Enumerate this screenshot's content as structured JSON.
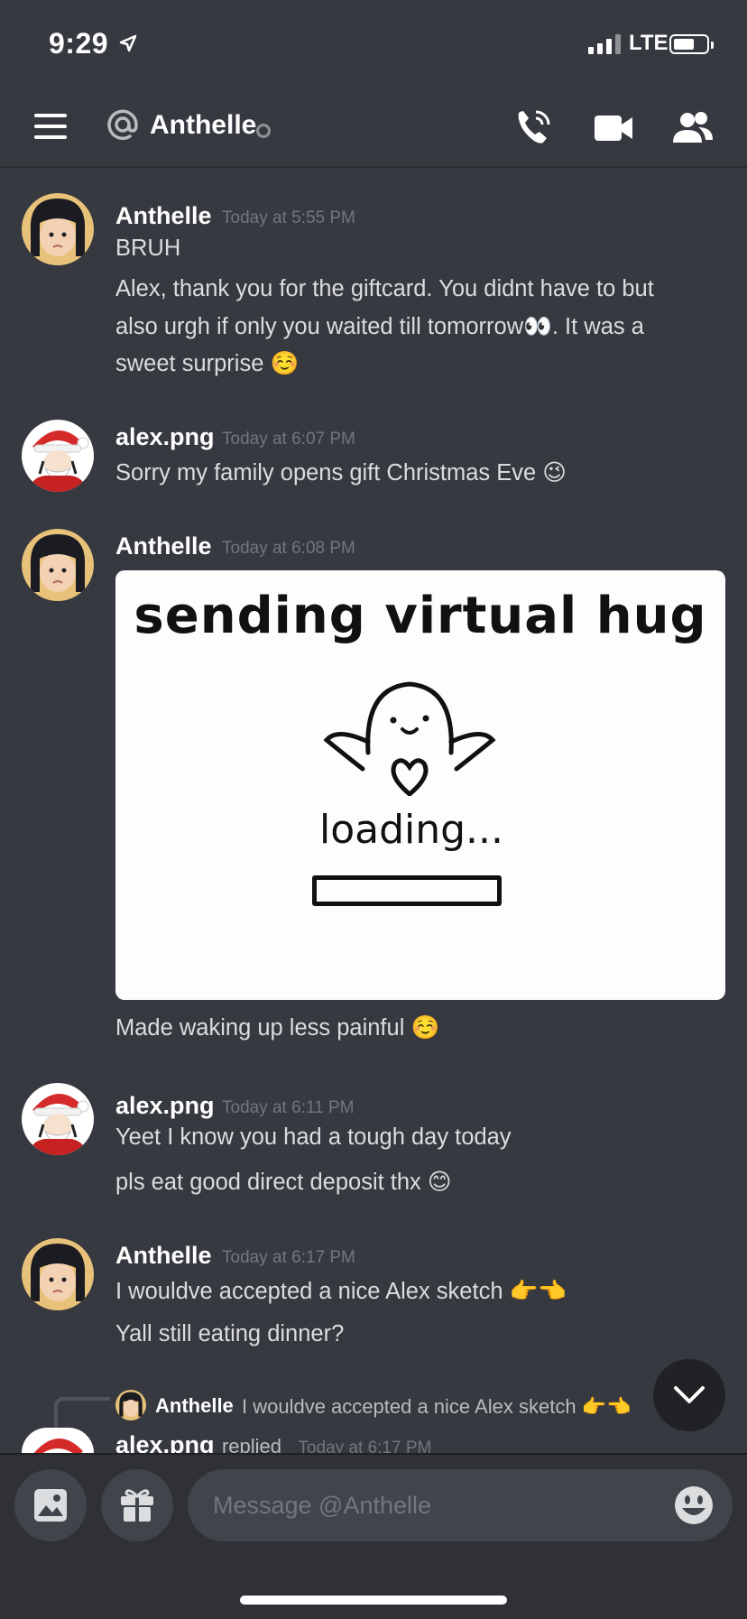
{
  "status_bar": {
    "time": "9:29",
    "network": "LTE"
  },
  "header": {
    "title": "Anthelle"
  },
  "icons": {
    "menu": "hamburger-icon",
    "mention": "at-sign-icon",
    "call": "phone-icon",
    "video": "video-camera-icon",
    "members": "people-icon",
    "scroll": "chevron-down-icon",
    "image": "image-icon",
    "gift": "gift-icon",
    "emoji": "smiley-icon"
  },
  "messages": [
    {
      "author": "Anthelle",
      "timestamp": "Today at 5:55 PM",
      "lines": [
        "BRUH",
        "Alex, thank you for the  giftcard. You didnt have to but",
        "also urgh if only you waited till tomorrow👀. It was a",
        "sweet surprise ☺️"
      ]
    },
    {
      "author": "alex.png",
      "timestamp": "Today at 6:07 PM",
      "lines": [
        "Sorry my family opens gift Christmas Eve 😉"
      ]
    },
    {
      "author": "Anthelle",
      "timestamp": "Today at 6:08 PM",
      "attachment": {
        "title": "sending virtual hug",
        "subtitle": "loading..."
      },
      "lines": [
        "Made waking up less painful ☺️"
      ]
    },
    {
      "author": "alex.png",
      "timestamp": "Today at 6:11 PM",
      "lines": [
        "Yeet I know you had a tough day today",
        "pls eat good direct deposit thx 😊"
      ]
    },
    {
      "author": "Anthelle",
      "timestamp": "Today at 6:17 PM",
      "lines": [
        "I wouldve accepted a nice Alex sketch 👉👈",
        "Yall still eating dinner?"
      ]
    }
  ],
  "reply": {
    "quoted_author": "Anthelle",
    "quoted_text": "I wouldve accepted a nice Alex sketch 👉👈",
    "author": "alex.png",
    "replied_label": "replied",
    "timestamp": "Today at 6:17 PM"
  },
  "composer": {
    "placeholder": "Message @Anthelle"
  },
  "colors": {
    "background": "#36393f",
    "composer": "#2f3136",
    "input": "#40444b",
    "muted": "#72767d"
  }
}
